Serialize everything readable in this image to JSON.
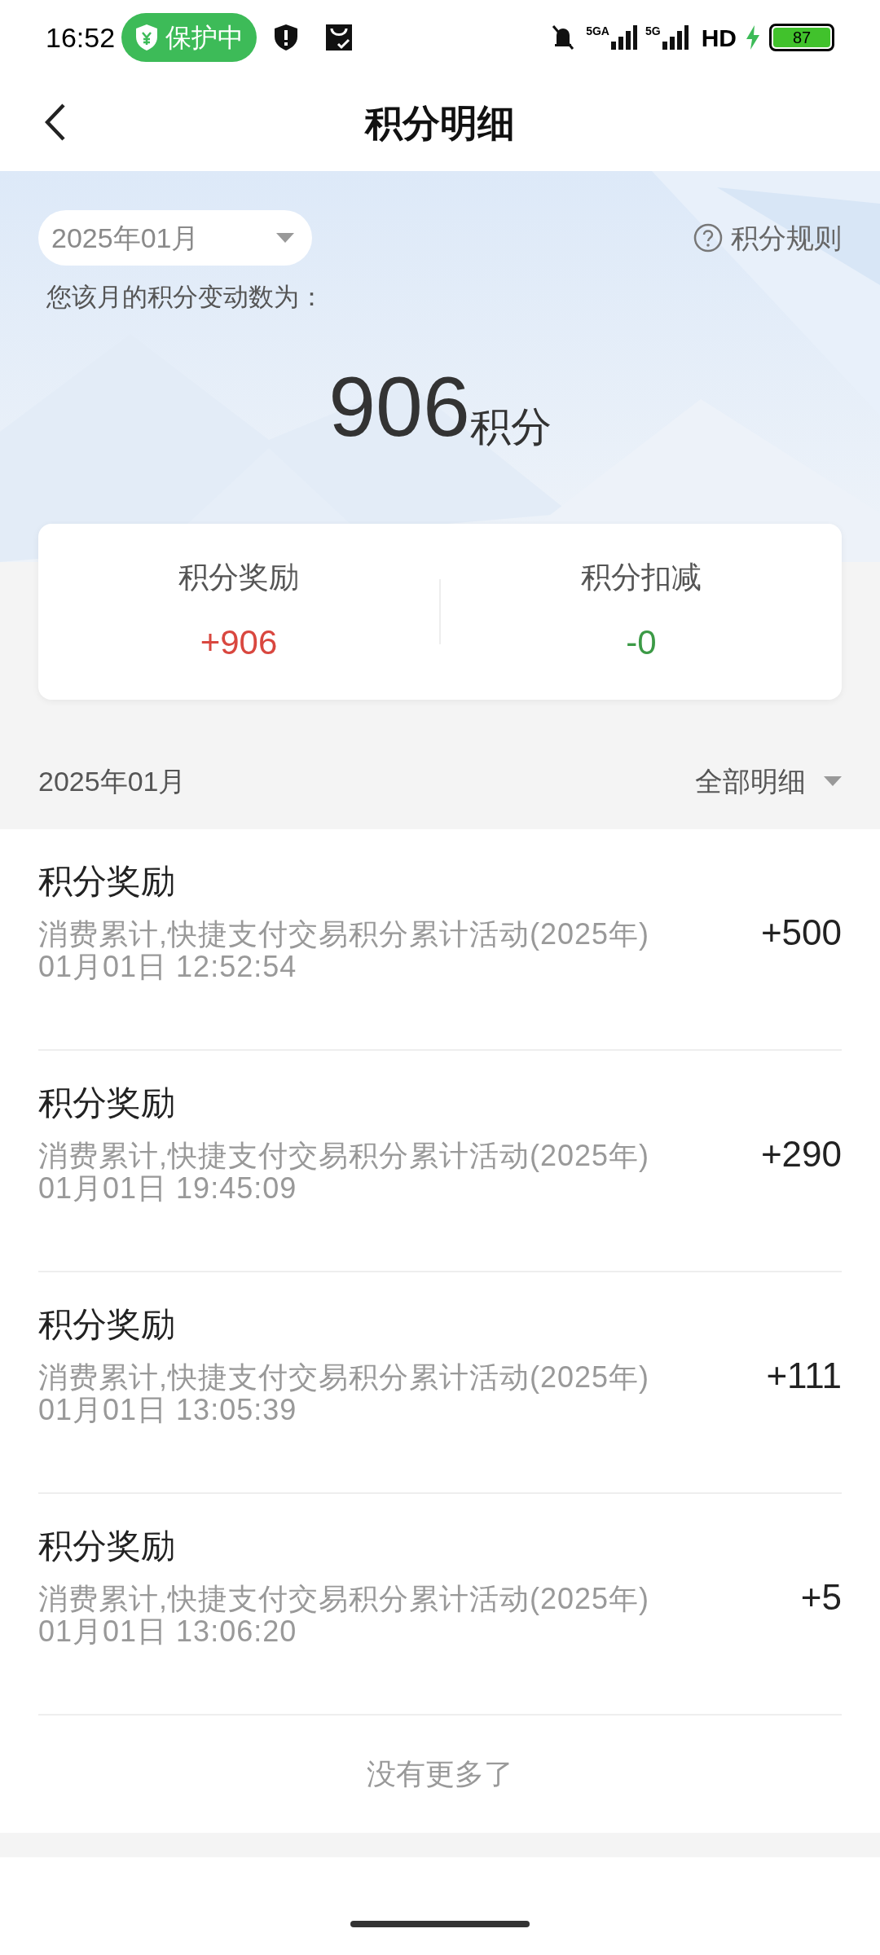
{
  "status_bar": {
    "time": "16:52",
    "protection_badge": "保护中",
    "networks": [
      "5GA",
      "5G"
    ],
    "hd": "HD",
    "battery": "87"
  },
  "header": {
    "title": "积分明细"
  },
  "summary": {
    "month": "2025年01月",
    "rules_link": "积分规则",
    "caption": "您该月的积分变动数为：",
    "total": "906",
    "unit": "积分",
    "stats": [
      {
        "label": "积分奖励",
        "value": "+906",
        "kind": "gain"
      },
      {
        "label": "积分扣减",
        "value": "-0",
        "kind": "loss"
      }
    ]
  },
  "list_header": {
    "month": "2025年01月",
    "filter": "全部明细"
  },
  "records": [
    {
      "title": "积分奖励",
      "description": "消费累计,快捷支付交易积分累计活动(2025年)",
      "time": "01月01日 12:52:54",
      "amount": "+500"
    },
    {
      "title": "积分奖励",
      "description": "消费累计,快捷支付交易积分累计活动(2025年)",
      "time": "01月01日 19:45:09",
      "amount": "+290"
    },
    {
      "title": "积分奖励",
      "description": "消费累计,快捷支付交易积分累计活动(2025年)",
      "time": "01月01日 13:05:39",
      "amount": "+111"
    },
    {
      "title": "积分奖励",
      "description": "消费累计,快捷支付交易积分累计活动(2025年)",
      "time": "01月01日 13:06:20",
      "amount": "+5"
    }
  ],
  "footer": "没有更多了"
}
